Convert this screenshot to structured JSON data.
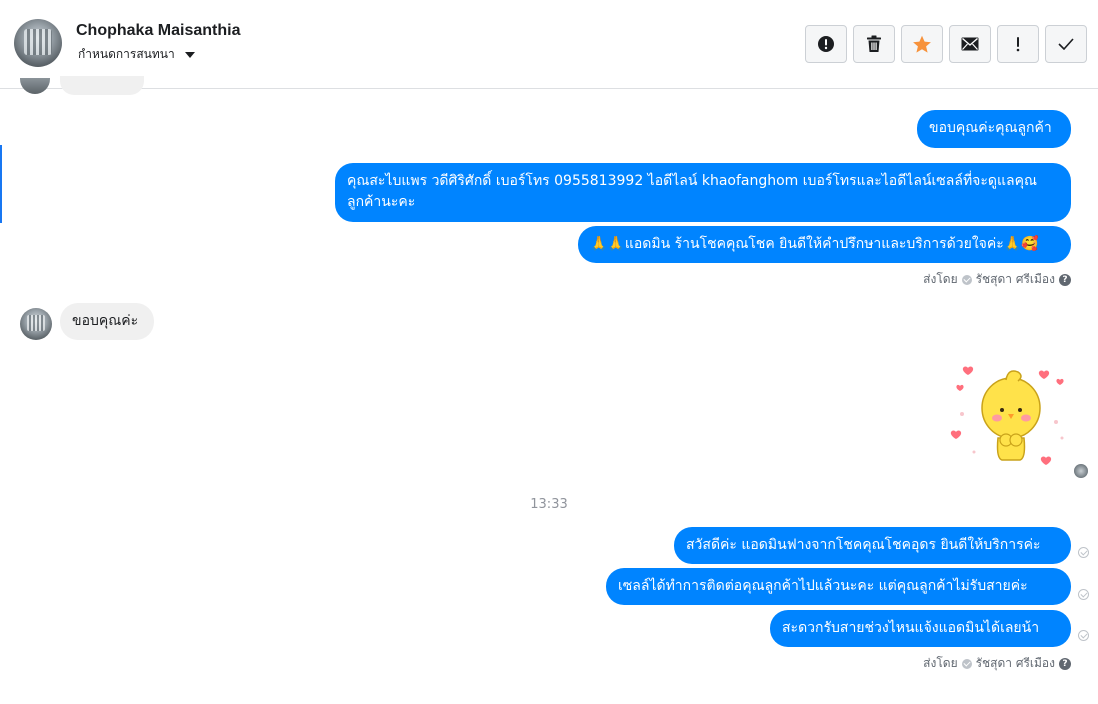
{
  "header": {
    "contact_name": "Chophaka Maisanthia",
    "assign_label": "กำหนดการสนทนา"
  },
  "toolbar": {
    "buttons": [
      {
        "name": "spam",
        "icon": "alert-circle-icon"
      },
      {
        "name": "delete",
        "icon": "trash-icon"
      },
      {
        "name": "star",
        "icon": "star-icon",
        "color": "#f7923b"
      },
      {
        "name": "mark-unread",
        "icon": "envelope-icon"
      },
      {
        "name": "follow-up",
        "icon": "exclamation-icon"
      },
      {
        "name": "mark-done",
        "icon": "check-icon"
      }
    ]
  },
  "messages": {
    "m1": "ขอบคุณค่ะคุณลูกค้า",
    "m2": "คุณสะไบแพร วดีศิริศักดิ์ เบอร์โทร 0955813992  ไอดีไลน์  khaofanghom   เบอร์โทรและไอดีไลน์เซลล์ที่จะดูแลคุณลูกค้านะคะ",
    "m3": "🙏🙏แอดมิน ร้านโชคคุณโชค ยินดีให้คำปรึกษาและบริการด้วยใจค่ะ🙏🥰",
    "in1": "ขอบคุณค่ะ",
    "m4": "สวัสดีค่ะ แอดมินฟางจากโชคคุณโชคอุดร ยินดีให้บริการค่ะ",
    "m5": "เซลล์ได้ทำการติดต่อคุณลูกค้าไปแล้วนะคะ  แต่คุณลูกค้าไม่รับสายค่ะ",
    "m6": "สะดวกรับสายช่วงไหนแจ้งแอดมินได้เลยน้า"
  },
  "sent_by": {
    "prefix": "ส่งโดย",
    "agent": "รัชสุดา ศรีเมือง",
    "help": "?"
  },
  "timestamp": "13:33",
  "colors": {
    "outgoing_bubble": "#0084ff",
    "incoming_bubble": "#f0f0f0",
    "accent": "#1877f2"
  }
}
